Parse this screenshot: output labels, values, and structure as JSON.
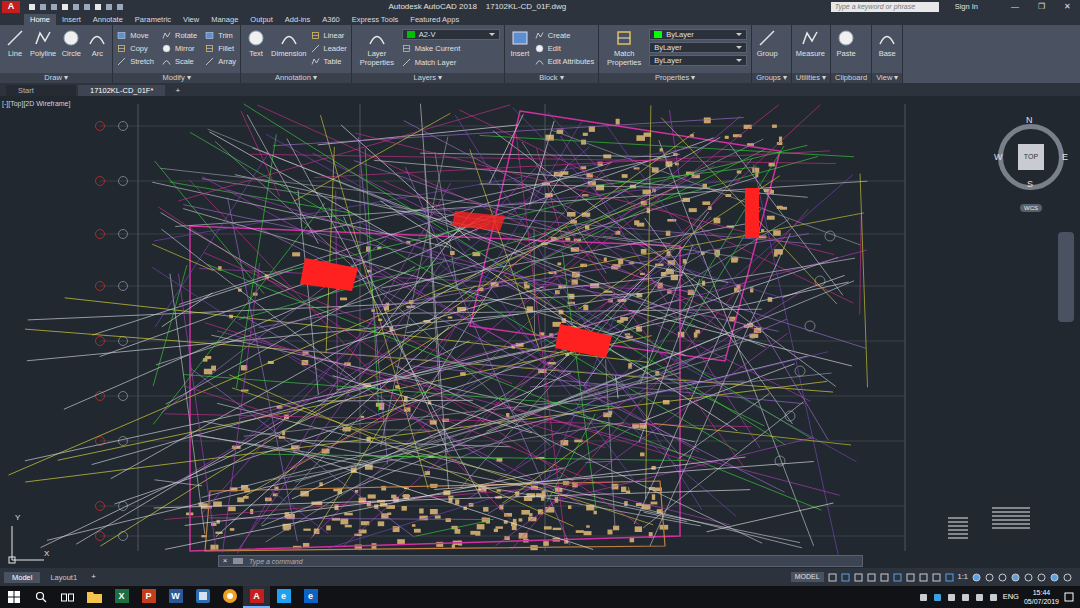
{
  "window": {
    "app_logo": "A",
    "title": "Autodesk AutoCAD 2018    17102KL-CD_01F.dwg",
    "search_placeholder": "Type a keyword or phrase",
    "sign_in": "Sign In",
    "controls": [
      "—",
      "❐",
      "✕"
    ]
  },
  "ribbon_tabs": [
    {
      "label": "Home",
      "selected": true
    },
    {
      "label": "Insert",
      "selected": false
    },
    {
      "label": "Annotate",
      "selected": false
    },
    {
      "label": "Parametric",
      "selected": false
    },
    {
      "label": "View",
      "selected": false
    },
    {
      "label": "Manage",
      "selected": false
    },
    {
      "label": "Output",
      "selected": false
    },
    {
      "label": "Add-ins",
      "selected": false
    },
    {
      "label": "A360",
      "selected": false
    },
    {
      "label": "Express Tools",
      "selected": false
    },
    {
      "label": "Featured Apps",
      "selected": false
    }
  ],
  "ribbon_panels": [
    {
      "title": "Draw ▾",
      "large": [
        "Line",
        "Polyline",
        "Circle",
        "Arc"
      ],
      "dropdowns": [],
      "small": []
    },
    {
      "title": "Modify ▾",
      "large": [],
      "dropdowns": [],
      "small": [
        "Move",
        "Copy",
        "Stretch",
        "Rotate",
        "Mirror",
        "Scale",
        "Trim",
        "Fillet",
        "Array"
      ]
    },
    {
      "title": "Annotation ▾",
      "large": [
        "Text",
        "Dimension"
      ],
      "dropdowns": [],
      "small": [
        "Linear",
        "Leader",
        "Table"
      ]
    },
    {
      "title": "Layers ▾",
      "large": [
        "Layer Properties"
      ],
      "dropdowns": [
        {
          "value": "A2-V",
          "swatch": "#00c000"
        }
      ],
      "small": [
        "Make Current",
        "Match Layer"
      ]
    },
    {
      "title": "Block ▾",
      "large": [
        "Insert"
      ],
      "dropdowns": [],
      "small": [
        "Create",
        "Edit",
        "Edit Attributes"
      ]
    },
    {
      "title": "Properties ▾",
      "large": [
        "Match Properties"
      ],
      "dropdowns": [
        {
          "value": "ByLayer",
          "swatch": "#00ff00"
        },
        {
          "value": "ByLayer"
        },
        {
          "value": "ByLayer"
        }
      ],
      "small": []
    },
    {
      "title": "Groups ▾",
      "large": [
        "Group"
      ],
      "dropdowns": [],
      "small": []
    },
    {
      "title": "Utilities ▾",
      "large": [
        "Measure"
      ],
      "dropdowns": [],
      "small": []
    },
    {
      "title": "Clipboard",
      "large": [
        "Paste"
      ],
      "dropdowns": [],
      "small": []
    },
    {
      "title": "View ▾",
      "large": [
        "Base"
      ],
      "dropdowns": [],
      "small": []
    }
  ],
  "file_tabs": [
    {
      "label": "Start",
      "selected": false
    },
    {
      "label": "17102KL-CD_01F*",
      "selected": true
    }
  ],
  "new_tab": "+",
  "viewport": {
    "label": "[-][Top][2D Wireframe]"
  },
  "viewcube": {
    "top": "TOP",
    "north": "N",
    "south": "S",
    "east": "E",
    "west": "W",
    "coordinate_system": "WCS"
  },
  "ucs": {
    "x": "X",
    "y": "Y"
  },
  "command_line": {
    "close": "×",
    "placeholder": "Type a command"
  },
  "layout_tabs": [
    {
      "label": "Model",
      "selected": true
    },
    {
      "label": "Layout1",
      "selected": false
    }
  ],
  "add_layout": "+",
  "status_bar": {
    "space": "MODEL",
    "scale": "1:1"
  },
  "taskbar": {
    "apps": [
      {
        "kind": "folder",
        "glyph": "",
        "color": "#f3c24f",
        "active": false
      },
      {
        "kind": "letter",
        "glyph": "X",
        "color": "#1d6f42",
        "active": false
      },
      {
        "kind": "letter",
        "glyph": "P",
        "color": "#c43e1c",
        "active": false
      },
      {
        "kind": "letter",
        "glyph": "W",
        "color": "#2b579a",
        "active": false
      },
      {
        "kind": "tile",
        "glyph": "",
        "color": "#2a6db5",
        "active": false
      },
      {
        "kind": "round",
        "glyph": "",
        "color": "#f0a020",
        "active": false
      },
      {
        "kind": "letter",
        "glyph": "A",
        "color": "#c41e1e",
        "active": true
      },
      {
        "kind": "letter",
        "glyph": "e",
        "color": "#1ea1f1",
        "active": false
      },
      {
        "kind": "letter",
        "glyph": "e",
        "color": "#0a64c8",
        "active": false
      }
    ],
    "language": "ENG",
    "time": "15:44",
    "date": "05/07/2019"
  }
}
